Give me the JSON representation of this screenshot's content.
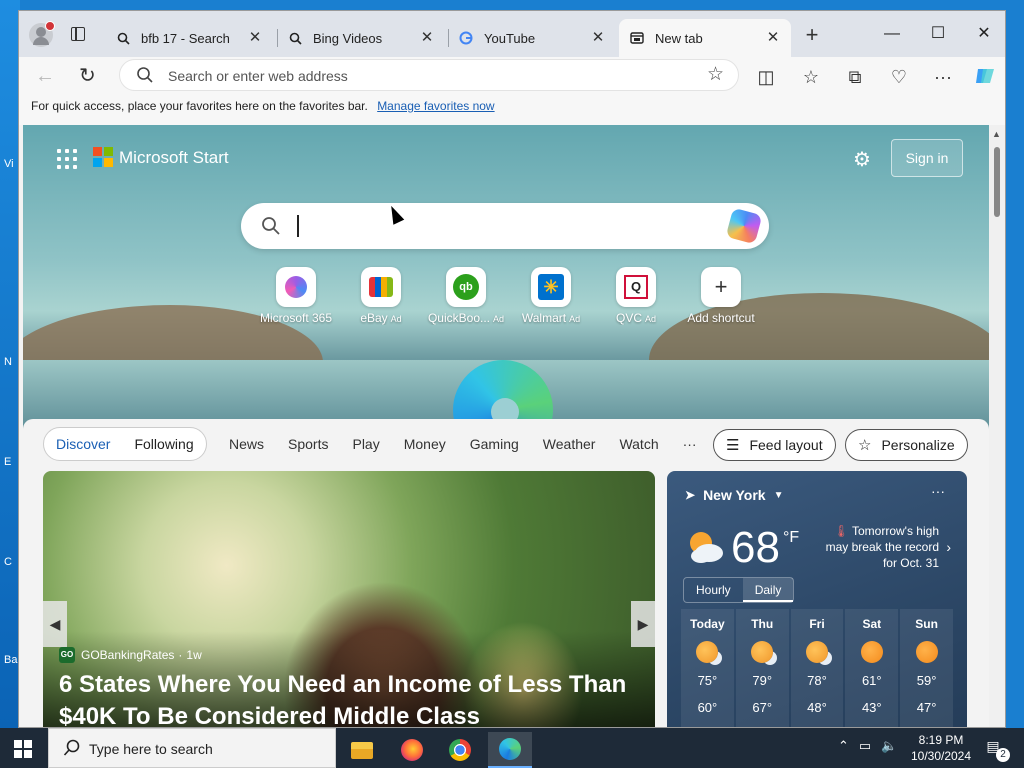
{
  "desktop": {
    "labels": [
      "Vi",
      "N",
      "E",
      "C",
      "Ba"
    ]
  },
  "tabs": [
    {
      "title": "bfb 17 - Search",
      "icon": "search-icon"
    },
    {
      "title": "Bing Videos",
      "icon": "search-icon"
    },
    {
      "title": "YouTube",
      "icon": "google-icon"
    },
    {
      "title": "New tab",
      "icon": "newtab-icon"
    }
  ],
  "toolbar": {
    "omnibox_placeholder": "Search or enter web address"
  },
  "favorites_bar": {
    "message": "For quick access, place your favorites here on the favorites bar.",
    "link": "Manage favorites now"
  },
  "start": {
    "brand": "Microsoft Start",
    "sign_in": "Sign in",
    "tiles": [
      {
        "label": "Microsoft 365",
        "ad": ""
      },
      {
        "label": "eBay",
        "ad": "Ad"
      },
      {
        "label": "QuickBoo...",
        "ad": "Ad"
      },
      {
        "label": "Walmart",
        "ad": "Ad"
      },
      {
        "label": "QVC",
        "ad": "Ad"
      },
      {
        "label": "Add shortcut",
        "ad": ""
      }
    ]
  },
  "feed": {
    "tabs": [
      "Discover",
      "Following"
    ],
    "categories": [
      "News",
      "Sports",
      "Play",
      "Money",
      "Gaming",
      "Weather",
      "Watch",
      "···"
    ],
    "feed_layout": "Feed layout",
    "personalize": "Personalize"
  },
  "story": {
    "source": "GOBankingRates",
    "source_logo": "GO",
    "age": "1w",
    "headline": "6 States Where You Need an Income of Less Than $40K To Be Considered Middle Class"
  },
  "weather": {
    "location": "New York",
    "temp": "68",
    "unit": "°F",
    "alert": "Tomorrow's high may break the record for Oct. 31",
    "toggle": [
      "Hourly",
      "Daily"
    ],
    "days": [
      {
        "name": "Today",
        "hi": "75°",
        "lo": "60°",
        "icon": "partly-cloudy"
      },
      {
        "name": "Thu",
        "hi": "79°",
        "lo": "67°",
        "icon": "partly-cloudy"
      },
      {
        "name": "Fri",
        "hi": "78°",
        "lo": "48°",
        "icon": "partly-cloudy"
      },
      {
        "name": "Sat",
        "hi": "61°",
        "lo": "43°",
        "icon": "sunny"
      },
      {
        "name": "Sun",
        "hi": "59°",
        "lo": "47°",
        "icon": "sunny"
      }
    ]
  },
  "taskbar": {
    "search_placeholder": "Type here to search",
    "time": "8:19 PM",
    "date": "10/30/2024",
    "notifications": "2"
  }
}
